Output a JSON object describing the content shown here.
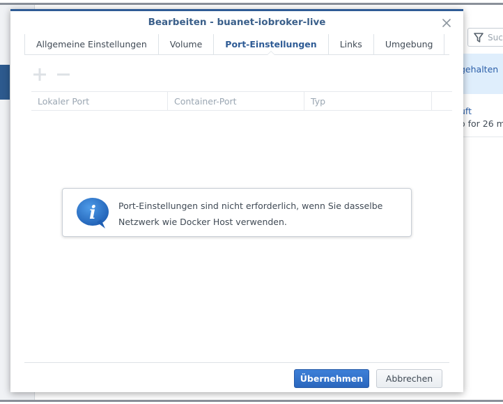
{
  "background": {
    "search_placeholder": "Suc",
    "row1_text": "gehalten",
    "row2_text1": "uft",
    "row2_text2": "o for 26 m"
  },
  "dialog": {
    "title": "Bearbeiten - buanet-iobroker-live",
    "tabs": [
      {
        "label": "Allgemeine Einstellungen",
        "active": false
      },
      {
        "label": "Volume",
        "active": false
      },
      {
        "label": "Port-Einstellungen",
        "active": true
      },
      {
        "label": "Links",
        "active": false
      },
      {
        "label": "Umgebung",
        "active": false
      }
    ],
    "toolbar": {
      "add_icon": "plus-icon",
      "remove_icon": "minus-icon"
    },
    "grid": {
      "columns": [
        "Lokaler Port",
        "Container-Port",
        "Typ"
      ],
      "rows": []
    },
    "info_message": "Port-Einstellungen sind nicht erforderlich, wenn Sie dasselbe Netzwerk wie Docker Host verwenden.",
    "buttons": {
      "apply": "Übernehmen",
      "cancel": "Abbrechen"
    }
  },
  "colors": {
    "accent": "#2e5b95",
    "primary_button": "#2a66bd",
    "info_icon": "#2a66bd"
  }
}
